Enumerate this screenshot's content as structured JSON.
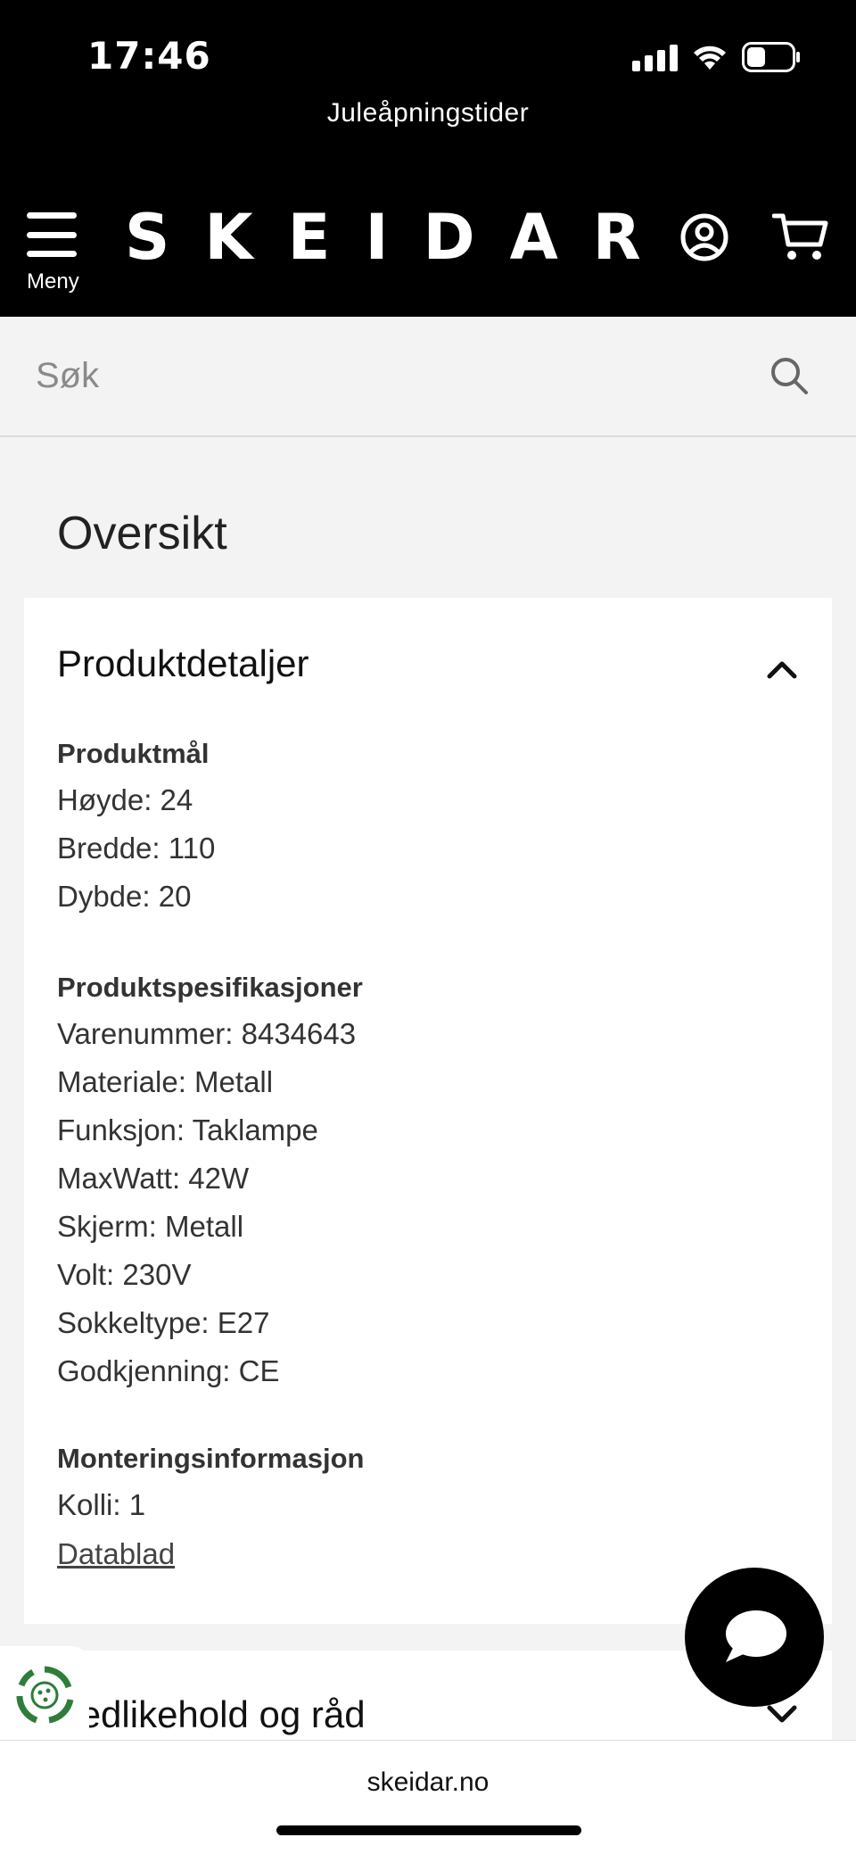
{
  "status_bar": {
    "time": "17:46"
  },
  "banner": {
    "text": "Juleåpningstider"
  },
  "header": {
    "menu_label": "Meny",
    "logo": "SKEIDAR",
    "account_icon": "account-icon",
    "cart_icon": "cart-icon"
  },
  "search": {
    "placeholder": "Søk",
    "icon": "search-icon"
  },
  "main": {
    "section_title": "Oversikt",
    "product_details": {
      "title": "Produktdetaljer",
      "expanded": true,
      "groups": [
        {
          "title": "Produktmål",
          "lines": [
            "Høyde: 24",
            "Bredde: 110",
            "Dybde: 20"
          ]
        },
        {
          "title": "Produktspesifikasjoner",
          "lines": [
            "Varenummer: 8434643",
            "Materiale: Metall",
            "Funksjon: Taklampe",
            "MaxWatt: 42W",
            "Skjerm: Metall",
            "Volt: 230V",
            "Sokkeltype: E27",
            "Godkjenning: CE"
          ]
        },
        {
          "title": "Monteringsinformasjon",
          "lines": [
            "Kolli: 1"
          ],
          "link": "Datablad"
        }
      ]
    },
    "maintenance": {
      "title": "Vedlikehold og råd",
      "expanded": false
    }
  },
  "browser": {
    "url": "skeidar.no"
  },
  "colors": {
    "header_bg": "#000000",
    "page_bg": "#f3f3f3",
    "card_bg": "#ffffff",
    "eco_green": "#2e7d3a"
  }
}
